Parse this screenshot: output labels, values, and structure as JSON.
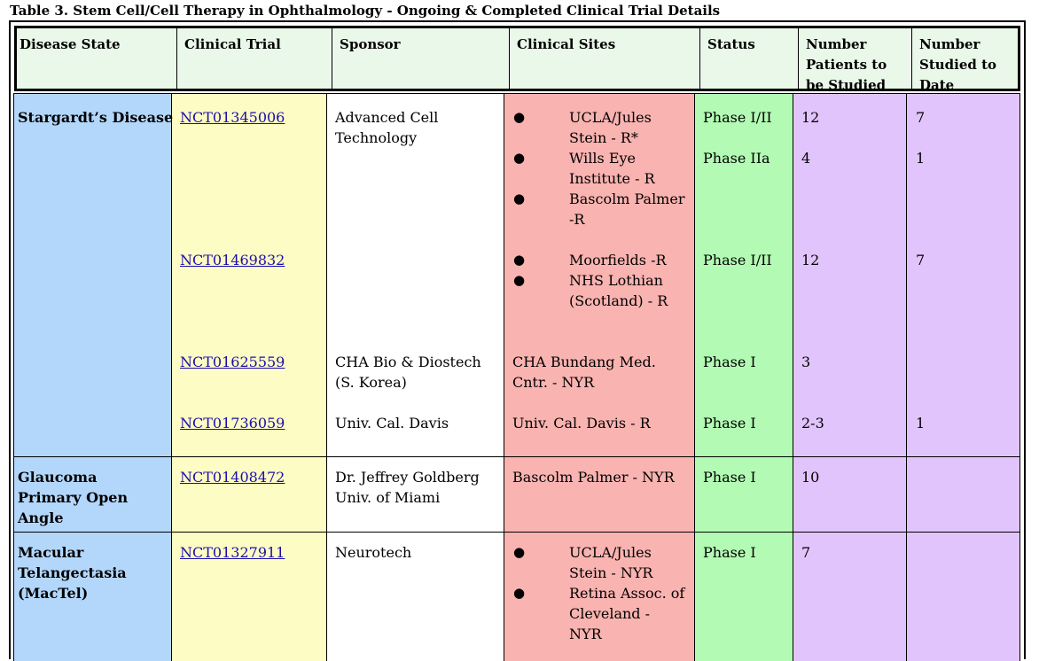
{
  "caption": "Table 3. Stem Cell/Cell Therapy in Ophthalmology - Ongoing & Completed Clinical Trial Details",
  "headers": {
    "disease": "Disease State",
    "trial": "Clinical Trial",
    "sponsor": "Sponsor",
    "sites": "Clinical Sites",
    "status": "Status",
    "num_planned": [
      "Number",
      "Patients to",
      "be Studied"
    ],
    "num_date": [
      "Number",
      "Studied to",
      "Date"
    ]
  },
  "bullet_char": "●",
  "colors": {
    "disease": "#b3d7fb",
    "trial": "#fdfcc4",
    "sponsor": "#ffffff",
    "sites": "#f9b3b0",
    "status": "#b3fbb4",
    "numbers": "#e1c4fb",
    "header": "#eaf8ea",
    "link": "#1a0dab"
  },
  "groups": {
    "stargardt": {
      "disease": [
        "Stargardt’s Disease"
      ],
      "trials": {
        "t1": {
          "id": "NCT01345006",
          "sponsor": [
            "Advanced Cell",
            "Technology"
          ],
          "sites": [
            [
              "UCLA/Jules",
              "Stein - R*"
            ],
            [
              "Wills Eye",
              "Institute - R"
            ],
            [
              "Bascolm Palmer",
              "-R"
            ]
          ],
          "status": [
            "Phase I/II",
            "Phase IIa"
          ],
          "planned": [
            "12",
            "4"
          ],
          "to_date": [
            "7",
            "1"
          ]
        },
        "t2": {
          "id": "NCT01469832",
          "sites": [
            [
              "Moorfields -R"
            ],
            [
              "NHS Lothian",
              "(Scotland) - R"
            ]
          ],
          "status": "Phase I/II",
          "planned": "12",
          "to_date": "7"
        },
        "t3": {
          "id": "NCT01625559",
          "sponsor": [
            "CHA Bio & Diostech",
            "(S. Korea)"
          ],
          "sites": [
            "CHA Bundang Med.",
            "Cntr. - NYR"
          ],
          "status": "Phase I",
          "planned": "3",
          "to_date": ""
        },
        "t4": {
          "id": "NCT01736059",
          "sponsor": [
            "Univ. Cal. Davis"
          ],
          "sites": [
            "Univ. Cal. Davis - R"
          ],
          "status": "Phase I",
          "planned": "2-3",
          "to_date": "1"
        }
      }
    },
    "glaucoma": {
      "disease": [
        "Glaucoma",
        "Primary Open",
        "Angle"
      ],
      "id": "NCT01408472",
      "sponsor": [
        "Dr. Jeffrey Goldberg",
        "Univ. of Miami"
      ],
      "sites": [
        "Bascolm Palmer - NYR"
      ],
      "status": "Phase I",
      "planned": "10",
      "to_date": ""
    },
    "mactel": {
      "disease": [
        "Macular",
        "Telangectasia",
        "(MacTel)"
      ],
      "id": "NCT01327911",
      "sponsor": [
        "Neurotech"
      ],
      "sites": [
        [
          "UCLA/Jules",
          "Stein - NYR"
        ],
        [
          "Retina Assoc. of",
          "Cleveland -",
          "NYR"
        ]
      ],
      "status": "Phase I",
      "planned": "7",
      "to_date": ""
    }
  }
}
